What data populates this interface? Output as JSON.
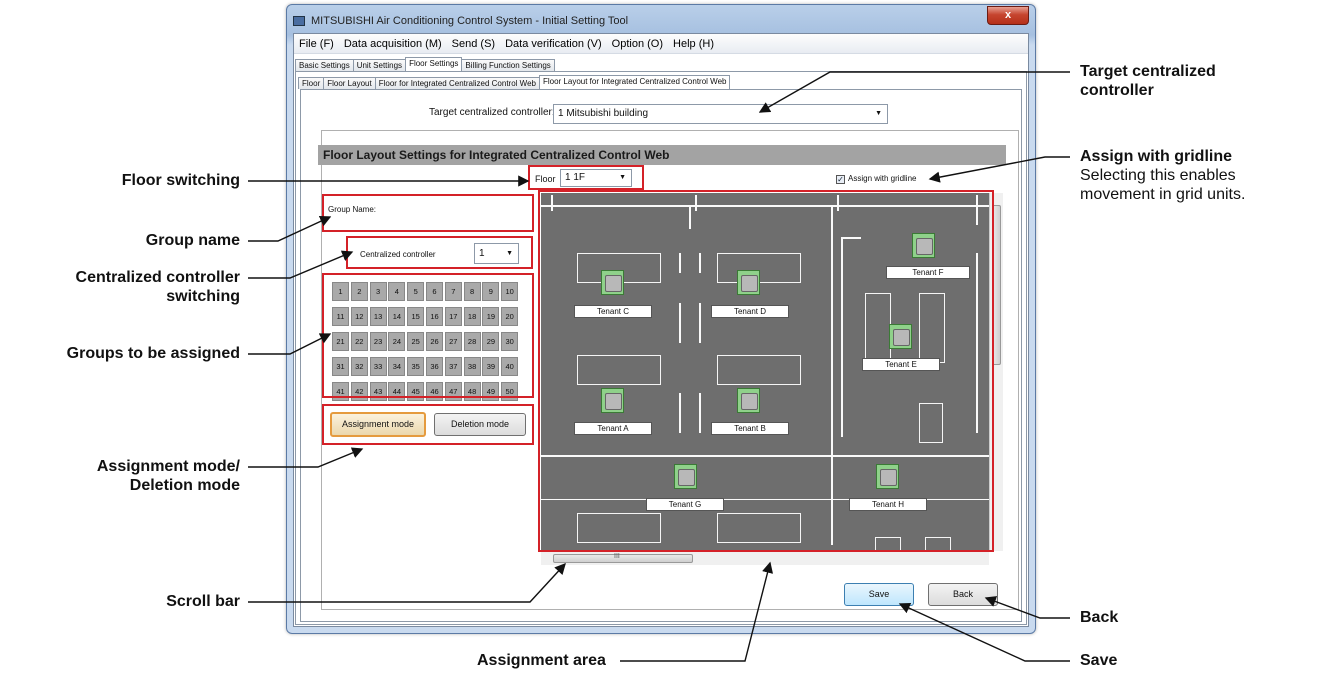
{
  "window": {
    "title": "MITSUBISHI Air Conditioning Control System - Initial Setting Tool",
    "close_label": "x"
  },
  "menu": [
    "File (F)",
    "Data acquisition (M)",
    "Send (S)",
    "Data verification (V)",
    "Option (O)",
    "Help (H)"
  ],
  "main_tabs": [
    "Basic Settings",
    "Unit Settings",
    "Floor Settings",
    "Billing Function Settings"
  ],
  "sub_tabs": [
    "Floor",
    "Floor Layout",
    "Floor for Integrated Centralized Control Web",
    "Floor Layout for Integrated Centralized Control Web"
  ],
  "target": {
    "label": "Target centralized controller:",
    "value": "1  Mitsubishi building"
  },
  "section_title": "Floor Layout Settings for Integrated Centralized Control Web",
  "floor": {
    "label": "Floor",
    "value": "1  1F"
  },
  "gridline_label": "Assign with gridline",
  "group_name_label": "Group Name:",
  "controller": {
    "label": "Centralized controller",
    "value": "1"
  },
  "groups": [
    "1",
    "2",
    "3",
    "4",
    "5",
    "6",
    "7",
    "8",
    "9",
    "10",
    "11",
    "12",
    "13",
    "14",
    "15",
    "16",
    "17",
    "18",
    "19",
    "20",
    "21",
    "22",
    "23",
    "24",
    "25",
    "26",
    "27",
    "28",
    "29",
    "30",
    "31",
    "32",
    "33",
    "34",
    "35",
    "36",
    "37",
    "38",
    "39",
    "40",
    "41",
    "42",
    "43",
    "44",
    "45",
    "46",
    "47",
    "48",
    "49",
    "50"
  ],
  "buttons": {
    "assignment": "Assignment mode",
    "deletion": "Deletion mode",
    "save": "Save",
    "back": "Back"
  },
  "tenants": [
    "Tenant C",
    "Tenant D",
    "Tenant F",
    "Tenant E",
    "Tenant A",
    "Tenant B",
    "Tenant G",
    "Tenant H"
  ],
  "scroll_glyph": "III",
  "callouts": {
    "floor_switching": "Floor switching",
    "group_name": "Group name",
    "controller_switching_1": "Centralized controller",
    "controller_switching_2": "switching",
    "groups_assigned": "Groups to be assigned",
    "mode_1": "Assignment mode/",
    "mode_2": "Deletion mode",
    "scroll_bar": "Scroll bar",
    "assignment_area": "Assignment area",
    "target_1": "Target centralized",
    "target_2": "controller",
    "gridline_title": "Assign with gridline",
    "gridline_desc_1": "Selecting this enables",
    "gridline_desc_2": "movement in grid units.",
    "back": "Back",
    "save": "Save"
  },
  "colors": {
    "highlight": "#d42128",
    "area": "#6e6e6e",
    "unit": "#8fd18a"
  }
}
